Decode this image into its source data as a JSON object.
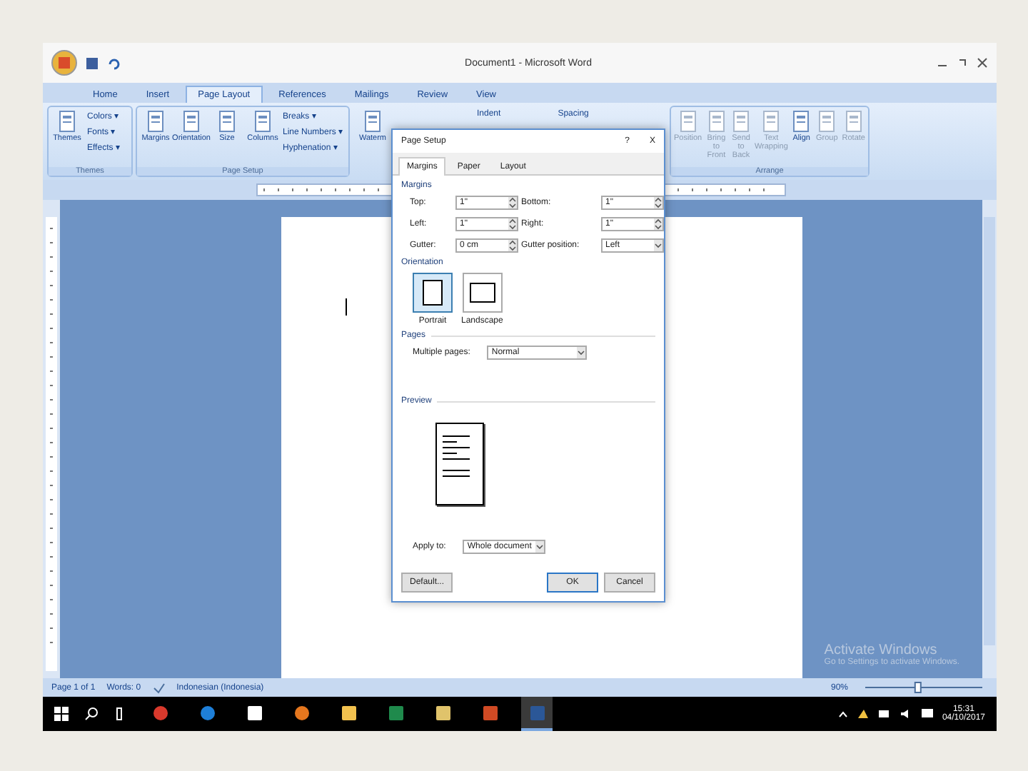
{
  "window": {
    "title": "Document1 - Microsoft Word"
  },
  "ribbon_tabs": [
    {
      "label": "Home",
      "selected": false
    },
    {
      "label": "Insert",
      "selected": false
    },
    {
      "label": "Page Layout",
      "selected": true
    },
    {
      "label": "References",
      "selected": false
    },
    {
      "label": "Mailings",
      "selected": false
    },
    {
      "label": "Review",
      "selected": false
    },
    {
      "label": "View",
      "selected": false
    }
  ],
  "ribbon_groups": [
    {
      "label": "Themes",
      "large": [
        {
          "label": "Themes",
          "disabled": false
        }
      ],
      "small": [
        "Colors ▾",
        "Fonts ▾",
        "Effects ▾"
      ]
    },
    {
      "label": "Page Setup",
      "large": [
        {
          "label": "Margins",
          "disabled": false
        },
        {
          "label": "Orientation",
          "disabled": false
        },
        {
          "label": "Size",
          "disabled": false
        },
        {
          "label": "Columns",
          "disabled": false
        }
      ],
      "small": [
        "Breaks ▾",
        "Line Numbers ▾",
        "Hyphenation ▾"
      ]
    },
    {
      "large": [
        {
          "label": "Waterm",
          "disabled": false
        }
      ]
    },
    {
      "small": [
        "Indent",
        "Spacing"
      ]
    },
    {
      "label": "Arrange",
      "large": [
        {
          "label": "Position",
          "disabled": true
        },
        {
          "label": "Bring to Front",
          "disabled": true
        },
        {
          "label": "Send to Back",
          "disabled": true
        },
        {
          "label": "Text Wrapping",
          "disabled": true
        },
        {
          "label": "Align",
          "disabled": false
        },
        {
          "label": "Group",
          "disabled": true
        },
        {
          "label": "Rotate",
          "disabled": true
        }
      ]
    }
  ],
  "watermark_notice": {
    "title": "Activate Windows",
    "text": "Go to Settings to activate Windows."
  },
  "dialog": {
    "title": "Page Setup",
    "help": "?",
    "close": "X",
    "tabs": [
      {
        "label": "Margins",
        "selected": true
      },
      {
        "label": "Paper",
        "selected": false
      },
      {
        "label": "Layout",
        "selected": false
      }
    ],
    "margins_title": "Margins",
    "fields": [
      {
        "label": "Top:",
        "value": "1\"",
        "kind": "spin"
      },
      {
        "label": "Bottom:",
        "value": "1\"",
        "kind": "spin"
      },
      {
        "label": "Left:",
        "value": "1\"",
        "kind": "spin"
      },
      {
        "label": "Right:",
        "value": "1\"",
        "kind": "spin"
      },
      {
        "label": "Gutter:",
        "value": "0 cm",
        "kind": "spin"
      },
      {
        "label": "Gutter position:",
        "value": "Left",
        "kind": "select"
      }
    ],
    "orientation_title": "Orientation",
    "orientations": [
      {
        "label": "Portrait",
        "selected": true
      },
      {
        "label": "Landscape",
        "selected": false
      }
    ],
    "pages_title": "Pages",
    "multiple_pages": {
      "label": "Multiple pages:",
      "value": "Normal"
    },
    "preview_title": "Preview",
    "apply_to": {
      "label": "Apply to:",
      "value": "Whole document"
    },
    "buttons": [
      {
        "label": "Default...",
        "default": false
      },
      {
        "label": "OK",
        "default": true
      },
      {
        "label": "Cancel",
        "default": false
      }
    ]
  },
  "status_bar": {
    "page": "Page 1 of 1",
    "words": "Words: 0",
    "language": "Indonesian (Indonesia)",
    "zoom": "90%",
    "zoom_slider": {
      "level": 0.45
    }
  },
  "taskbar": {
    "apps": [
      {
        "kind": "chrome",
        "selected": false
      },
      {
        "kind": "edge",
        "selected": false
      },
      {
        "kind": "store",
        "selected": false
      },
      {
        "kind": "firefox",
        "selected": false
      },
      {
        "kind": "explorer",
        "selected": false
      },
      {
        "kind": "excel",
        "selected": false
      },
      {
        "kind": "folder",
        "selected": false
      },
      {
        "kind": "powerpoint",
        "selected": false
      },
      {
        "kind": "word",
        "selected": true
      }
    ],
    "time": "15:31",
    "date": "04/10/2017"
  }
}
